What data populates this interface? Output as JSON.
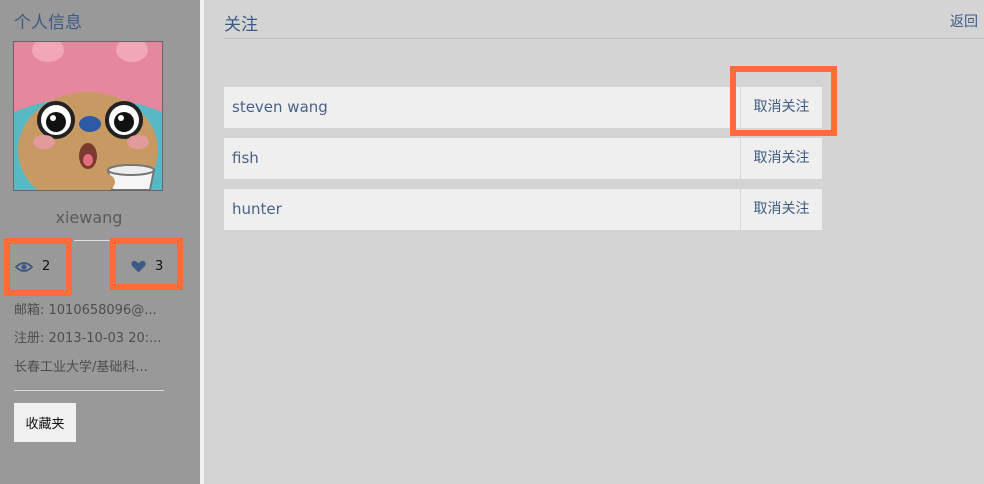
{
  "sidebar": {
    "title": "个人信息",
    "username": "xiewang",
    "stats": {
      "views": "2",
      "likes": "3"
    },
    "info": [
      "邮箱: 1010658096@...",
      "注册: 2013-10-03 20:...",
      "长春工业大学/基础科..."
    ],
    "favorites_button": "收藏夹"
  },
  "main": {
    "title": "关注",
    "back_label": "返回",
    "following": [
      {
        "name": "steven wang",
        "action": "取消关注"
      },
      {
        "name": "fish",
        "action": "取消关注"
      },
      {
        "name": "hunter",
        "action": "取消关注"
      }
    ]
  },
  "colors": {
    "highlight": "#ff6c38",
    "link": "#3f5a84",
    "sidebar_bg": "#999999",
    "main_bg": "#d4d4d4"
  }
}
